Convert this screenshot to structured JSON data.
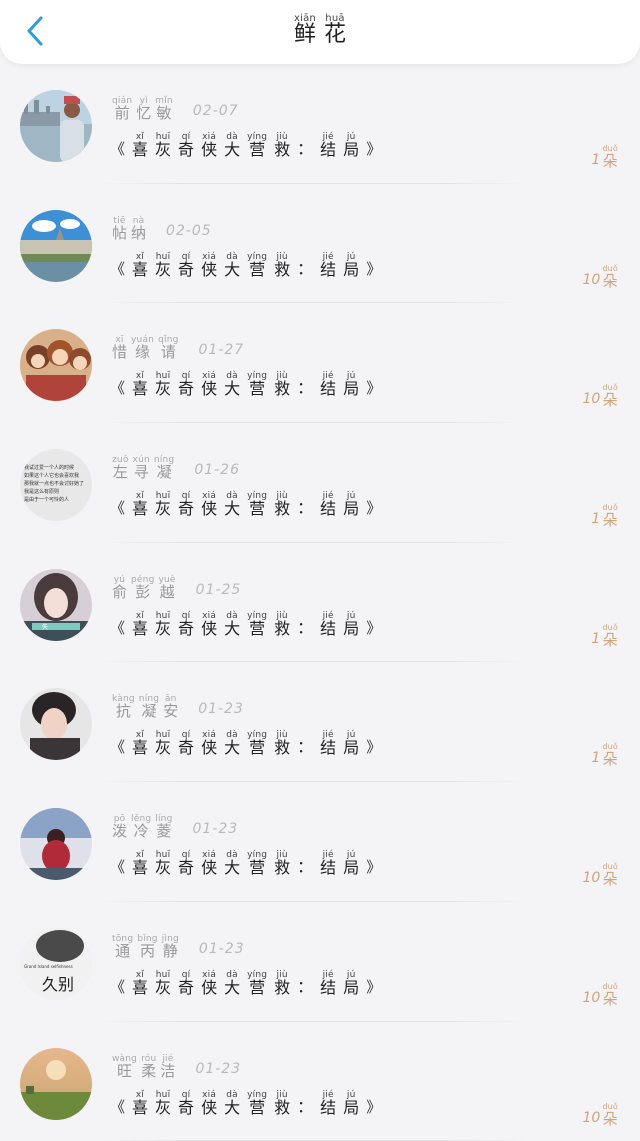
{
  "header": {
    "title_chars": [
      {
        "hz": "鲜",
        "py": "xiān"
      },
      {
        "hz": "花",
        "py": "huā"
      }
    ]
  },
  "book_title": {
    "open": "《",
    "close": "》",
    "chars_before_colon": [
      {
        "hz": "喜",
        "py": "xǐ"
      },
      {
        "hz": "灰",
        "py": "huī"
      },
      {
        "hz": "奇",
        "py": "qí"
      },
      {
        "hz": "侠",
        "py": "xiá"
      },
      {
        "hz": "大",
        "py": "dà"
      },
      {
        "hz": "营",
        "py": "yíng"
      },
      {
        "hz": "救",
        "py": "jiù"
      }
    ],
    "colon": "：",
    "chars_after_colon": [
      {
        "hz": "结",
        "py": "jié"
      },
      {
        "hz": "局",
        "py": "jú"
      }
    ]
  },
  "gift_unit": {
    "hz": "朵",
    "py": "duǒ"
  },
  "rows": [
    {
      "name": [
        {
          "hz": "前",
          "py": "qián"
        },
        {
          "hz": "忆",
          "py": "yì"
        },
        {
          "hz": "敏",
          "py": "mǐn"
        }
      ],
      "date": "02-07",
      "count": "1",
      "avatar": "man-by-water"
    },
    {
      "name": [
        {
          "hz": "帖",
          "py": "tiē"
        },
        {
          "hz": "纳",
          "py": "nà"
        }
      ],
      "date": "02-05",
      "count": "10",
      "avatar": "city-bridge"
    },
    {
      "name": [
        {
          "hz": "惜",
          "py": "xī"
        },
        {
          "hz": "缘",
          "py": "yuán"
        },
        {
          "hz": "请",
          "py": "qǐng"
        }
      ],
      "date": "01-27",
      "count": "10",
      "avatar": "anime-group"
    },
    {
      "name": [
        {
          "hz": "左",
          "py": "zuǒ"
        },
        {
          "hz": "寻",
          "py": "xún"
        },
        {
          "hz": "凝",
          "py": "níng"
        }
      ],
      "date": "01-26",
      "count": "1",
      "avatar": "text-image"
    },
    {
      "name": [
        {
          "hz": "俞",
          "py": "yú"
        },
        {
          "hz": "彭",
          "py": "péng"
        },
        {
          "hz": "越",
          "py": "yuè"
        }
      ],
      "date": "01-25",
      "count": "1",
      "avatar": "girl-portrait"
    },
    {
      "name": [
        {
          "hz": "抗",
          "py": "kàng"
        },
        {
          "hz": "凝",
          "py": "níng"
        },
        {
          "hz": "安",
          "py": "ān"
        }
      ],
      "date": "01-23",
      "count": "1",
      "avatar": "boy-portrait"
    },
    {
      "name": [
        {
          "hz": "泼",
          "py": "pō"
        },
        {
          "hz": "冷",
          "py": "lěng"
        },
        {
          "hz": "菱",
          "py": "líng"
        }
      ],
      "date": "01-23",
      "count": "10",
      "avatar": "child-photo"
    },
    {
      "name": [
        {
          "hz": "通",
          "py": "tōng"
        },
        {
          "hz": "丙",
          "py": "bǐng"
        },
        {
          "hz": "静",
          "py": "jìng"
        }
      ],
      "date": "01-23",
      "count": "10",
      "avatar": "farewell-image"
    },
    {
      "name": [
        {
          "hz": "旺",
          "py": "wàng"
        },
        {
          "hz": "柔",
          "py": "róu"
        },
        {
          "hz": "洁",
          "py": "jié"
        }
      ],
      "date": "01-23",
      "count": "10",
      "avatar": "sunset-field"
    }
  ],
  "avatar_texts": {
    "text-image_lines": [
      "我试过爱一个人的时候",
      "如果这个人它也会喜欢我",
      "那我就一点也不会讨好她了",
      "我是这么有原则",
      "是由于一个可怜的人"
    ],
    "girl-portrait_tag": "失",
    "farewell-image_small": "Grand Island selfishness",
    "farewell-image_big": "久别"
  },
  "colors": {
    "accent_blue": "#2d9cdb",
    "gift_color": "#d6a27a",
    "background": "#f4f4f6"
  },
  "icons": {
    "back": "chevron-left-icon"
  }
}
